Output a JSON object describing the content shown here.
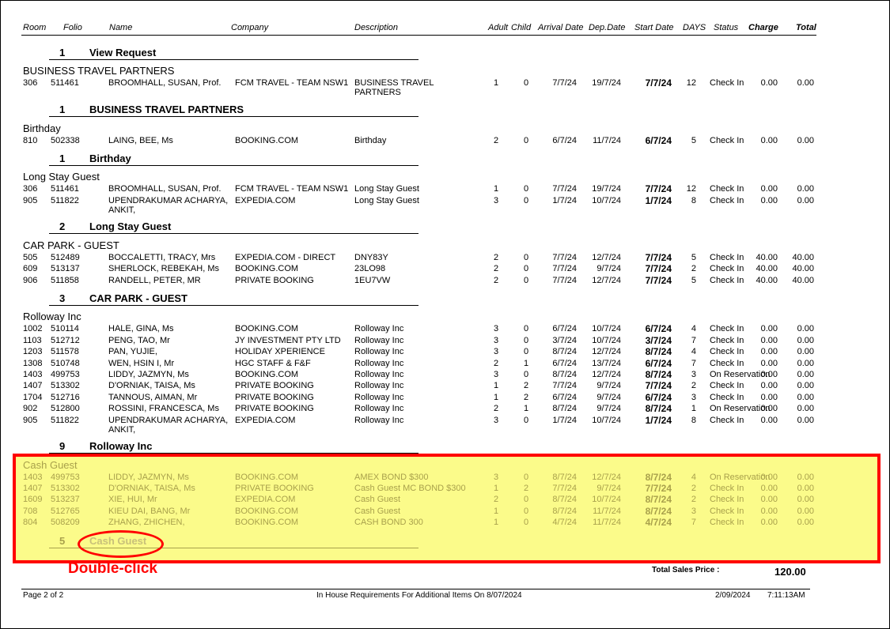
{
  "columns": {
    "room": "Room",
    "folio": "Folio",
    "name": "Name",
    "company": "Company",
    "description": "Description",
    "adult": "Adult",
    "child": "Child",
    "arrival": "Arrival Date",
    "dep": "Dep.Date",
    "start": "Start Date",
    "days": "DAYS",
    "status": "Status",
    "charge": "Charge",
    "total": "Total"
  },
  "top_group_footer": {
    "count": "1",
    "label": "View Request"
  },
  "groups": [
    {
      "title": "BUSINESS TRAVEL PARTNERS",
      "footer_count": "1",
      "footer_label": "BUSINESS TRAVEL PARTNERS",
      "rows": [
        [
          "306",
          "511461",
          "BROOMHALL, SUSAN, Prof.",
          "FCM TRAVEL - TEAM NSW1",
          "BUSINESS TRAVEL|PARTNERS",
          "1",
          "0",
          "7/7/24",
          "19/7/24",
          "7/7/24",
          "12",
          "Check In",
          "0.00",
          "0.00"
        ]
      ]
    },
    {
      "title": "Birthday",
      "footer_count": "1",
      "footer_label": "Birthday",
      "rows": [
        [
          "810",
          "502338",
          "LAING, BEE, Ms",
          "BOOKING.COM",
          "Birthday",
          "2",
          "0",
          "6/7/24",
          "11/7/24",
          "6/7/24",
          "5",
          "Check In",
          "0.00",
          "0.00"
        ]
      ]
    },
    {
      "title": "Long Stay Guest",
      "footer_count": "2",
      "footer_label": "Long Stay Guest",
      "rows": [
        [
          "306",
          "511461",
          "BROOMHALL, SUSAN, Prof.",
          "FCM TRAVEL - TEAM NSW1",
          "Long Stay Guest",
          "1",
          "0",
          "7/7/24",
          "19/7/24",
          "7/7/24",
          "12",
          "Check In",
          "0.00",
          "0.00"
        ],
        [
          "905",
          "511822",
          "UPENDRAKUMAR ACHARYA,|ANKIT,",
          "EXPEDIA.COM",
          "Long Stay Guest",
          "3",
          "0",
          "1/7/24",
          "10/7/24",
          "1/7/24",
          "8",
          "Check In",
          "0.00",
          "0.00"
        ]
      ]
    },
    {
      "title": "CAR PARK - GUEST",
      "footer_count": "3",
      "footer_label": "CAR PARK - GUEST",
      "rows": [
        [
          "505",
          "512489",
          "BOCCALETTI, TRACY, Mrs",
          "EXPEDIA.COM - DIRECT",
          "DNY83Y",
          "2",
          "0",
          "7/7/24",
          "12/7/24",
          "7/7/24",
          "5",
          "Check In",
          "40.00",
          "40.00"
        ],
        [
          "609",
          "513137",
          "SHERLOCK, REBEKAH, Ms",
          "BOOKING.COM",
          "23LO98",
          "2",
          "0",
          "7/7/24",
          "9/7/24",
          "7/7/24",
          "2",
          "Check In",
          "40.00",
          "40.00"
        ],
        [
          "906",
          "511858",
          "RANDELL, PETER, MR",
          "PRIVATE BOOKING",
          "1EU7VW",
          "2",
          "0",
          "7/7/24",
          "12/7/24",
          "7/7/24",
          "5",
          "Check In",
          "40.00",
          "40.00"
        ]
      ]
    },
    {
      "title": "Rolloway Inc",
      "footer_count": "9",
      "footer_label": "Rolloway Inc",
      "rows": [
        [
          "1002",
          "510114",
          "HALE, GINA, Ms",
          "BOOKING.COM",
          "Rolloway Inc",
          "3",
          "0",
          "6/7/24",
          "10/7/24",
          "6/7/24",
          "4",
          "Check In",
          "0.00",
          "0.00"
        ],
        [
          "1103",
          "512712",
          "PENG, TAO, Mr",
          "JY INVESTMENT PTY LTD",
          "Rolloway Inc",
          "3",
          "0",
          "3/7/24",
          "10/7/24",
          "3/7/24",
          "7",
          "Check In",
          "0.00",
          "0.00"
        ],
        [
          "1203",
          "511578",
          "PAN, YUJIE,",
          "HOLIDAY XPERIENCE",
          "Rolloway Inc",
          "3",
          "0",
          "8/7/24",
          "12/7/24",
          "8/7/24",
          "4",
          "Check In",
          "0.00",
          "0.00"
        ],
        [
          "1308",
          "510748",
          "WEN, HSIN I, Mr",
          "HGC STAFF & F&F",
          "Rolloway Inc",
          "2",
          "1",
          "6/7/24",
          "13/7/24",
          "6/7/24",
          "7",
          "Check In",
          "0.00",
          "0.00"
        ],
        [
          "1403",
          "499753",
          "LIDDY, JAZMYN, Ms",
          "BOOKING.COM",
          "Rolloway Inc",
          "3",
          "0",
          "8/7/24",
          "12/7/24",
          "8/7/24",
          "3",
          "On Reservation",
          "0.00",
          "0.00"
        ],
        [
          "1407",
          "513302",
          "D'ORNIAK, TAISA, Ms",
          "PRIVATE BOOKING",
          "Rolloway Inc",
          "1",
          "2",
          "7/7/24",
          "9/7/24",
          "7/7/24",
          "2",
          "Check In",
          "0.00",
          "0.00"
        ],
        [
          "1704",
          "512716",
          "TANNOUS, AIMAN, Mr",
          "PRIVATE BOOKING",
          "Rolloway Inc",
          "1",
          "2",
          "6/7/24",
          "9/7/24",
          "6/7/24",
          "3",
          "Check In",
          "0.00",
          "0.00"
        ],
        [
          "902",
          "512800",
          "ROSSINI, FRANCESCA, Ms",
          "PRIVATE BOOKING",
          "Rolloway Inc",
          "2",
          "1",
          "8/7/24",
          "9/7/24",
          "8/7/24",
          "1",
          "On Reservation",
          "0.00",
          "0.00"
        ],
        [
          "905",
          "511822",
          "UPENDRAKUMAR ACHARYA,|ANKIT,",
          "EXPEDIA.COM",
          "Rolloway Inc",
          "3",
          "0",
          "1/7/24",
          "10/7/24",
          "1/7/24",
          "8",
          "Check In",
          "0.00",
          "0.00"
        ]
      ]
    },
    {
      "title": "Cash Guest",
      "footer_count": "5",
      "footer_label": "Cash Guest",
      "faded": true,
      "rows": [
        [
          "1403",
          "499753",
          "LIDDY, JAZMYN, Ms",
          "BOOKING.COM",
          "AMEX BOND $300",
          "3",
          "0",
          "8/7/24",
          "12/7/24",
          "8/7/24",
          "4",
          "On Reservation",
          "0.00",
          "0.00"
        ],
        [
          "1407",
          "513302",
          "D'ORNIAK, TAISA, Ms",
          "PRIVATE BOOKING",
          "Cash Guest MC BOND $300",
          "1",
          "2",
          "7/7/24",
          "9/7/24",
          "7/7/24",
          "2",
          "Check In",
          "0.00",
          "0.00"
        ],
        [
          "1609",
          "513237",
          "XIE, HUI, Mr",
          "EXPEDIA.COM",
          "Cash Guest",
          "2",
          "0",
          "8/7/24",
          "10/7/24",
          "8/7/24",
          "2",
          "Check In",
          "0.00",
          "0.00"
        ],
        [
          "708",
          "512765",
          "KIEU DAI, BANG, Mr",
          "BOOKING.COM",
          "Cash Guest",
          "1",
          "0",
          "8/7/24",
          "11/7/24",
          "8/7/24",
          "3",
          "Check In",
          "0.00",
          "0.00"
        ],
        [
          "804",
          "508209",
          "ZHANG, ZHICHEN,",
          "BOOKING.COM",
          "CASH BOND 300",
          "1",
          "0",
          "4/7/24",
          "11/7/24",
          "4/7/24",
          "7",
          "Check In",
          "0.00",
          "0.00"
        ]
      ]
    }
  ],
  "annotation": {
    "label": "Double-click",
    "color": "#ff0000"
  },
  "totals": {
    "label": "Total Sales Price :",
    "value": "120.00"
  },
  "footer": {
    "page": "Page 2 of 2",
    "title": "In House Requirements For Additional Items On 8/07/2024",
    "date": "2/09/2024",
    "time": "7:11:13AM"
  },
  "colors": {
    "highlight_bg": "#fbfb8a",
    "highlight_border": "#ff0000",
    "faded_text": "#a9a14c"
  }
}
